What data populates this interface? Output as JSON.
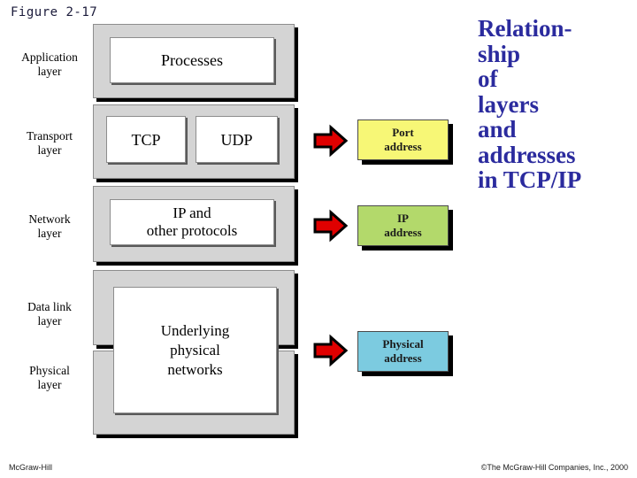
{
  "figure": {
    "label": "Figure 2-17"
  },
  "title": {
    "lines": [
      "Relation-",
      "ship",
      "of",
      "layers",
      "and",
      "addresses",
      "in TCP/IP"
    ]
  },
  "layers": [
    {
      "label_line1": "Application",
      "label_line2": "layer",
      "content": "Processes"
    },
    {
      "label_line1": "Transport",
      "label_line2": "layer",
      "protocols": [
        "TCP",
        "UDP"
      ]
    },
    {
      "label_line1": "Network",
      "label_line2": "layer",
      "content_line1": "IP and",
      "content_line2": "other protocols"
    },
    {
      "label_line1": "Data link",
      "label_line2": "layer"
    },
    {
      "label_line1": "Physical",
      "label_line2": "layer"
    }
  ],
  "spanning_box": {
    "line1": "Underlying",
    "line2": "physical",
    "line3": "networks"
  },
  "addresses": [
    {
      "line1": "Port",
      "line2": "address",
      "color": "#f7f776",
      "arrow_color": "#e00000"
    },
    {
      "line1": "IP",
      "line2": "address",
      "color": "#b3d96b",
      "arrow_color": "#e00000"
    },
    {
      "line1": "Physical",
      "line2": "address",
      "color": "#7ccbe0",
      "arrow_color": "#e00000"
    }
  ],
  "colors": {
    "title_blue": "#2b2b9e",
    "layer_grey": "#d4d4d4",
    "arrow_red": "#e00000",
    "shadow_black": "#000000"
  },
  "footer": {
    "left": "McGraw-Hill",
    "right": "©The McGraw-Hill Companies, Inc., 2000"
  }
}
